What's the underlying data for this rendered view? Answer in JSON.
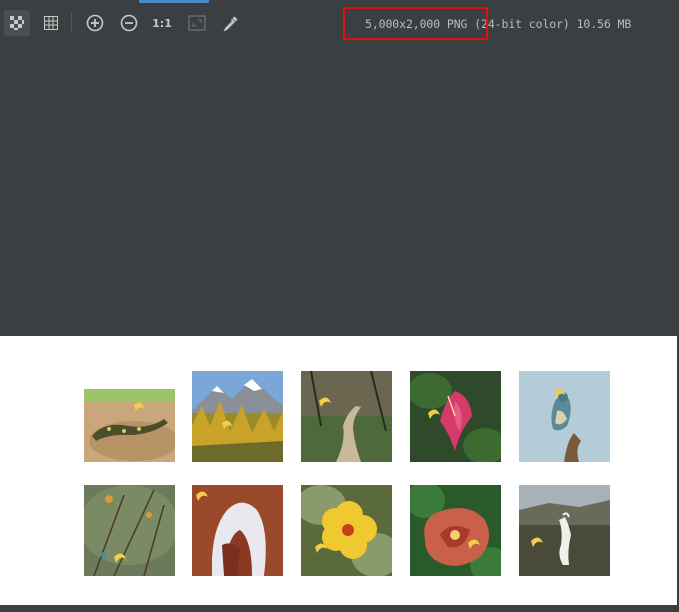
{
  "toolbar": {
    "buttons": [
      {
        "name": "chessboard-icon",
        "active": true
      },
      {
        "name": "grid-icon",
        "active": false
      },
      {
        "name": "zoom-in-icon",
        "active": false
      },
      {
        "name": "zoom-out-icon",
        "active": false
      },
      {
        "name": "actual-size-icon",
        "label": "1:1"
      },
      {
        "name": "fit-to-window-icon",
        "active": false
      },
      {
        "name": "color-picker-icon",
        "active": false
      }
    ],
    "actual_size_label": "1:1"
  },
  "image_info": {
    "dimensions": "5,000x2,000",
    "format": "PNG",
    "color": "(24-bit color)",
    "size": "10.56 MB"
  },
  "colors": {
    "background": "#3c3f41",
    "highlight": "#e01010",
    "accent": "#4a88c7"
  },
  "thumbnails": [
    {
      "subject": "lizard"
    },
    {
      "subject": "mountain-autumn"
    },
    {
      "subject": "forest-path"
    },
    {
      "subject": "pink-flower"
    },
    {
      "subject": "bird-on-branch"
    },
    {
      "subject": "birds-in-tree"
    },
    {
      "subject": "rock-arch"
    },
    {
      "subject": "yellow-hibiscus"
    },
    {
      "subject": "red-flower"
    },
    {
      "subject": "egret-valley"
    }
  ]
}
